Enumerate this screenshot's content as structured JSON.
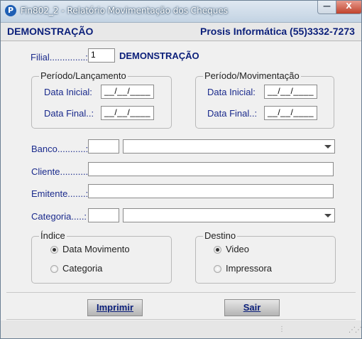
{
  "window": {
    "title": "Fin802_2 - Relatório Movimentação dos Cheques",
    "app_icon_letter": "P",
    "minimize_glyph": "—",
    "close_glyph": "X"
  },
  "header": {
    "company_name": "DEMONSTRAÇÃO",
    "vendor": "Prosis Informática (55)3332-7273"
  },
  "filial": {
    "label": "Filial..............:",
    "value": "1",
    "name": "DEMONSTRAÇÃO"
  },
  "periodo_lancamento": {
    "title": "Período/Lançamento",
    "data_inicial_label": "Data Inicial:",
    "data_inicial_value": "__/__/____",
    "data_final_label": "Data Final..:",
    "data_final_value": "__/__/____"
  },
  "periodo_movimentacao": {
    "title": "Período/Movimentação",
    "data_inicial_label": "Data Inicial:",
    "data_inicial_value": "__/__/____",
    "data_final_label": "Data Final..:",
    "data_final_value": "__/__/____"
  },
  "banco": {
    "label": "Banco...........:",
    "code": "",
    "selected": ""
  },
  "cliente": {
    "label": "Cliente...........:",
    "value": ""
  },
  "emitente": {
    "label": "Emitente.......:",
    "value": ""
  },
  "categoria": {
    "label": "Categoria.....:",
    "code": "",
    "selected": ""
  },
  "indice": {
    "title": "Índice",
    "options": [
      "Data Movimento",
      "Categoria"
    ],
    "selected": "Data Movimento"
  },
  "destino": {
    "title": "Destino",
    "options": [
      "Video",
      "Impressora"
    ],
    "selected": "Video"
  },
  "buttons": {
    "print_label": "Imprimir",
    "exit_label": "Sair"
  },
  "icons": [
    "app-logo-icon",
    "minimize-icon",
    "close-icon",
    "dropdown-arrow-icon",
    "resize-grip-icon"
  ]
}
